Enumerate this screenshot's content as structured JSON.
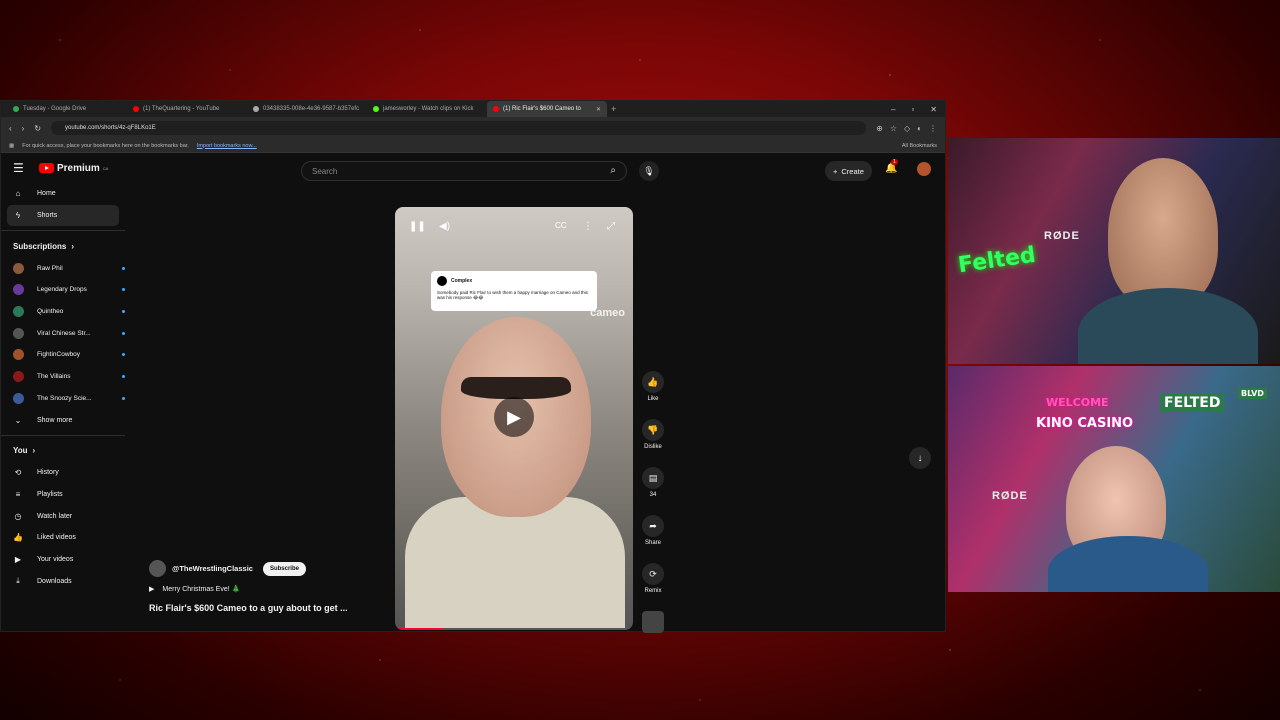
{
  "tabs": [
    {
      "label": "Tuesday - Google Drive",
      "color": "#34a853"
    },
    {
      "label": "(1) TheQuartering - YouTube",
      "color": "#ff0000"
    },
    {
      "label": "03438335-008e-4e36-9587-b357efc",
      "color": "#aaaaaa"
    },
    {
      "label": "jamesworley - Watch clips on Kick",
      "color": "#53fc18"
    },
    {
      "label": "(1) Ric Flair's $600 Cameo to",
      "color": "#ff0000"
    }
  ],
  "address": {
    "url": "youtube.com/shorts/4z-qF8LKo1E"
  },
  "bookmarks": {
    "text": "For quick access, place your bookmarks here on the bookmarks bar.",
    "import_link": "Import bookmarks now...",
    "all": "All Bookmarks"
  },
  "yt": {
    "logo": "Premium",
    "logo_region": "CA",
    "search_placeholder": "Search",
    "create_label": "Create",
    "notif_count": "1"
  },
  "sidebar": {
    "home": "Home",
    "shorts": "Shorts",
    "subscriptions": "Subscriptions",
    "channels": [
      {
        "name": "Raw Phil",
        "color": "#8a5a3a"
      },
      {
        "name": "Legendary Drops",
        "color": "#6a3a9a"
      },
      {
        "name": "Quintheo",
        "color": "#2a7a5a"
      },
      {
        "name": "Viral Chinese Str...",
        "color": "#555555"
      },
      {
        "name": "FightinCowboy",
        "color": "#a0522d"
      },
      {
        "name": "The Villains",
        "color": "#8a1a1a"
      },
      {
        "name": "The Snoozy Scie...",
        "color": "#3a5a9a"
      }
    ],
    "show_more": "Show more",
    "you": "You",
    "you_items": [
      "History",
      "Playlists",
      "Watch later",
      "Liked videos",
      "Your videos",
      "Downloads"
    ]
  },
  "short": {
    "tweet_author": "Complex",
    "tweet_text": "Somebody paid Ric Flair to wish them a happy marriage on Cameo and this was his response 😂😂",
    "watermark": "cameo",
    "progress": 0.2,
    "channel": "@TheWrestlingClassic",
    "subscribe": "Subscribe",
    "music": "Merry Christmas Eve! 🎄",
    "title": "Ric Flair's $600 Cameo to a guy about to get ..."
  },
  "actions": {
    "like": "Like",
    "dislike": "Dislike",
    "comments": "34",
    "share": "Share",
    "remix": "Remix"
  },
  "cams": {
    "mic_brand": "RØDE",
    "sign_welcome": "WELCOME",
    "sign_casino": "KINO CASINO",
    "sign_felted": "FELTED",
    "sign_blvd": "BLVD",
    "sign_neon": "Felted"
  }
}
